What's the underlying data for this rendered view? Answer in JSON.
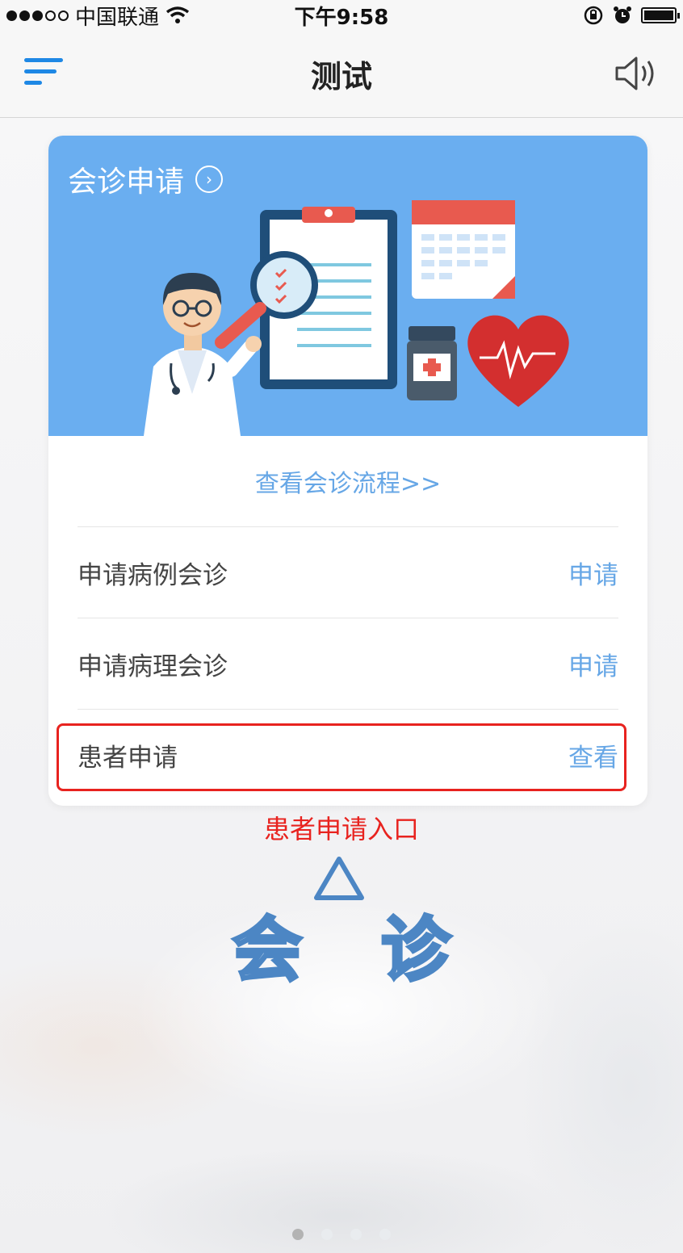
{
  "status_bar": {
    "carrier": "中国联通",
    "time": "下午9:58"
  },
  "nav": {
    "title": "测试"
  },
  "card": {
    "banner_title": "会诊申请",
    "flow_link": "查看会诊流程>>",
    "rows": [
      {
        "label": "申请病例会诊",
        "action": "申请"
      },
      {
        "label": "申请病理会诊",
        "action": "申请"
      },
      {
        "label": "患者申请",
        "action": "查看"
      }
    ]
  },
  "annotation": "患者申请入口",
  "logo": {
    "char1": "会",
    "char2": "诊"
  },
  "colors": {
    "accent_blue": "#1e88e5",
    "banner_blue": "#6aaef0",
    "link_blue": "#67a7e6",
    "annotation_red": "#e8231f"
  },
  "pager": {
    "pages": 4,
    "current": 1
  }
}
